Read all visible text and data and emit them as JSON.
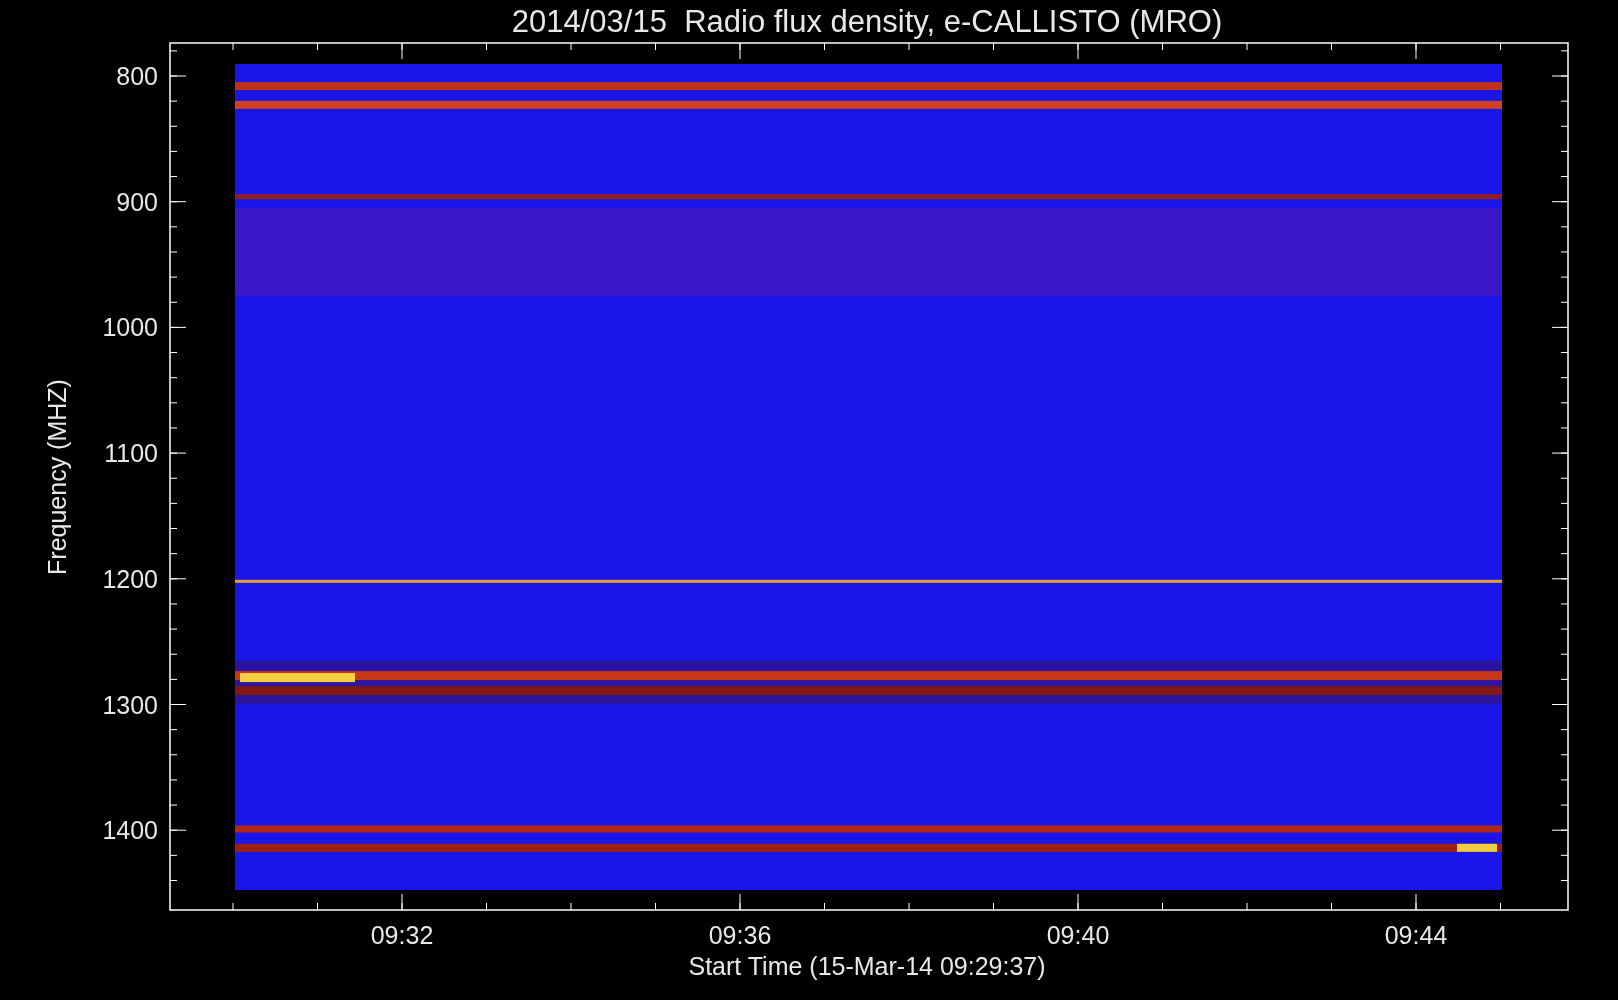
{
  "title": "2014/03/15  Radio flux density, e-CALLISTO (MRO)",
  "y_axis": {
    "label": "Frequency (MHZ)",
    "ticks": [
      "800",
      "900",
      "1000",
      "1100",
      "1200",
      "1300",
      "1400"
    ]
  },
  "x_axis": {
    "label": "Start Time (15-Mar-14 09:29:37)",
    "ticks": [
      "09:32",
      "09:36",
      "09:40",
      "09:44"
    ]
  }
}
